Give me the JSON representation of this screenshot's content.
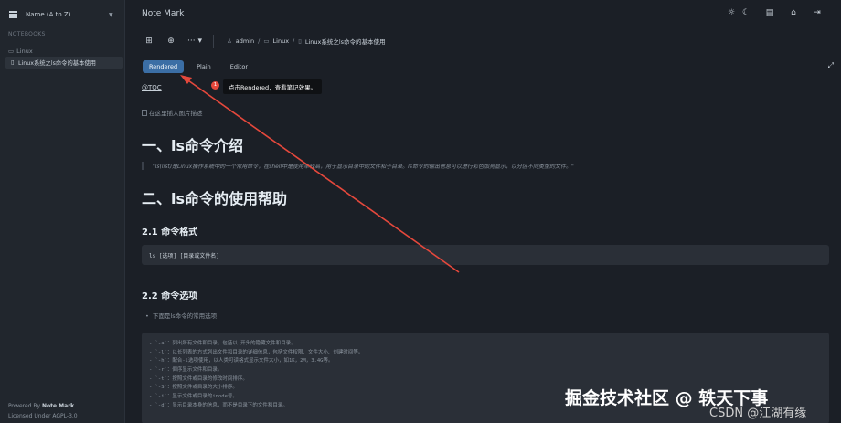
{
  "sidebar": {
    "sort_label": "Name (A to Z)",
    "section_label": "NOTEBOOKS",
    "folder": "Linux",
    "note": "Linux系统之ls命令的基本使用",
    "footer_powered": "Powered By ",
    "footer_brand": "Note Mark",
    "footer_license": "Licensed Under AGPL-3.0"
  },
  "header": {
    "title": "Note Mark",
    "icons": [
      "sun-icon",
      "moon-icon",
      "document-icon",
      "home-icon",
      "logout-icon"
    ]
  },
  "toolbar": {
    "breadcrumb": {
      "user": "admin",
      "folder": "Linux",
      "note": "Linux系统之ls命令的基本使用"
    }
  },
  "tabs": [
    "Rendered",
    "Plain",
    "Editor"
  ],
  "tooltip": {
    "number": "1",
    "text": "点击Rendered，查看笔记效果。"
  },
  "document": {
    "toc": "@TOC",
    "image_alt": "在这里插入图片描述",
    "h1_intro": "一、ls命令介绍",
    "quote": "\"ls(list)是Linux操作系统中的一个常用命令，在shell中是使用率较高，用于显示目录中的文件和子目录。ls命令的输出信息可以进行彩色加亮显示，以分区不同类型的文件。\"",
    "h1_help": "二、ls命令的使用帮助",
    "h2_format": "2.1 命令格式",
    "format_code": "ls [选项] [目录或文件名]",
    "h2_options": "2.2 命令选项",
    "bullet": "下面是ls命令的常用选项",
    "options": [
      "- `-a`：列出所有文件和目录，包括以.开头的隐藏文件和目录。",
      "- `-l`：以长列表的方式列出文件和目录的详细信息，包括文件权限、文件大小、创建时间等。",
      "- `-h`：配合-l选项使用，以人类可读格式显示文件大小，如1K，2M，3.4G等。",
      "- `-r`：倒序显示文件和目录。",
      "- `-t`：按照文件或目录的修改时间排序。",
      "- `-S`：按照文件或目录的大小排序。",
      "- `-i`：显示文件或目录的inode号。",
      "- `-d`：显示目录本身的信息，而不是目录下的文件和目录。"
    ]
  },
  "watermark": {
    "main": "掘金技术社区 @ 轶天下事",
    "sub": "CSDN @江湖有缘"
  },
  "colors": {
    "background": "#1b1f26",
    "sidebar": "#21262d",
    "active_tab": "#3b6ea5",
    "annotation_red": "#e5483c"
  }
}
